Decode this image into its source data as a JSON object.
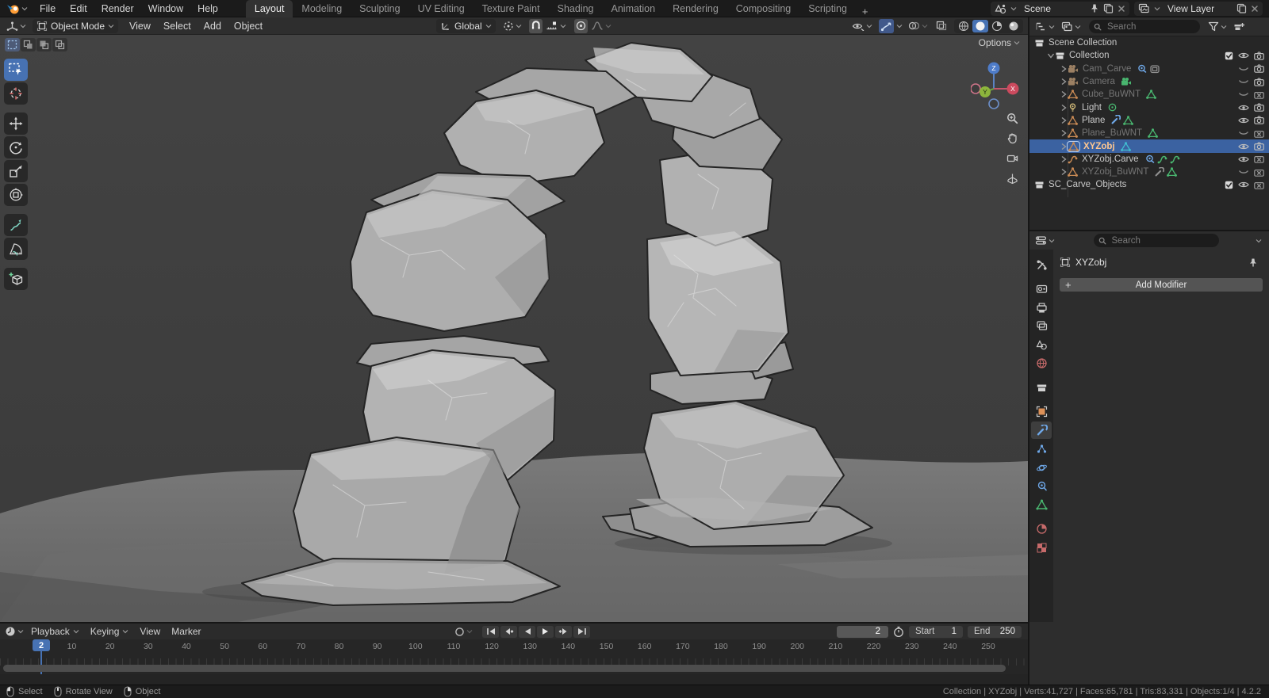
{
  "colors": {
    "accent": "#4772b3",
    "object-orange": "#dd9158",
    "modifier-blue": "#6fa8e8",
    "data-green": "#49b56f",
    "data-teal": "#41bcd0",
    "world-red": "#c66a6a"
  },
  "topbar": {
    "menus": [
      "File",
      "Edit",
      "Render",
      "Window",
      "Help"
    ],
    "workspaces": [
      "Layout",
      "Modeling",
      "Sculpting",
      "UV Editing",
      "Texture Paint",
      "Shading",
      "Animation",
      "Rendering",
      "Compositing",
      "Scripting"
    ],
    "active_workspace": "Layout",
    "new_workspace_label": "+",
    "scene": {
      "value": "Scene"
    },
    "view_layer": {
      "value": "View Layer"
    }
  },
  "viewport": {
    "header": {
      "mode": "Object Mode",
      "menus": [
        "View",
        "Select",
        "Add",
        "Object"
      ],
      "orientation": "Global"
    },
    "options_label": "Options"
  },
  "toolbar": {
    "tools": [
      {
        "name": "select-box",
        "active": true
      },
      {
        "name": "cursor"
      },
      {
        "name": "move",
        "group_gap": true
      },
      {
        "name": "rotate"
      },
      {
        "name": "scale"
      },
      {
        "name": "transform"
      },
      {
        "name": "annotate",
        "group_gap": true
      },
      {
        "name": "measure"
      },
      {
        "name": "add-cube",
        "group_gap": true
      }
    ]
  },
  "outliner": {
    "search_placeholder": "Search",
    "rows": [
      {
        "name": "Scene Collection",
        "icon": "collection",
        "level": 0,
        "badges": [],
        "toggles": []
      },
      {
        "name": "Collection",
        "icon": "collection",
        "level": 1,
        "expand": "open",
        "badges": [],
        "toggles": [
          "check",
          "eye-open",
          "camera"
        ]
      },
      {
        "name": "Cam_Carve",
        "icon": "camera-obj",
        "level": 2,
        "expand": "closed",
        "dimmed": true,
        "badges": [
          "constraint",
          "camera-data-dim"
        ],
        "toggles": [
          "eye-closed",
          "camera"
        ]
      },
      {
        "name": "Camera",
        "icon": "camera-obj",
        "level": 2,
        "expand": "closed",
        "dimmed": true,
        "badges": [
          "camera-data"
        ],
        "toggles": [
          "eye-closed",
          "camera"
        ]
      },
      {
        "name": "Cube_BuWNT",
        "icon": "mesh-obj",
        "level": 2,
        "expand": "closed",
        "dimmed": true,
        "badges": [
          "mesh-data"
        ],
        "toggles": [
          "eye-closed",
          "camera-x"
        ]
      },
      {
        "name": "Light",
        "icon": "light-obj",
        "level": 2,
        "expand": "closed",
        "badges": [
          "light-data"
        ],
        "toggles": [
          "eye-open",
          "camera"
        ]
      },
      {
        "name": "Plane",
        "icon": "mesh-obj",
        "level": 2,
        "expand": "closed",
        "badges": [
          "modifier",
          "mesh-data"
        ],
        "toggles": [
          "eye-open",
          "camera"
        ]
      },
      {
        "name": "Plane_BuWNT",
        "icon": "mesh-obj",
        "level": 2,
        "expand": "closed",
        "dimmed": true,
        "badges": [
          "mesh-data"
        ],
        "toggles": [
          "eye-closed",
          "camera-x"
        ]
      },
      {
        "name": "XYZobj",
        "icon": "mesh-obj",
        "level": 2,
        "expand": "closed",
        "selected": true,
        "badges": [
          "mesh-data-teal"
        ],
        "toggles": [
          "eye-open",
          "camera"
        ]
      },
      {
        "name": "XYZobj.Carve",
        "icon": "curve-obj",
        "level": 2,
        "expand": "closed",
        "badges": [
          "constraint",
          "curve-data",
          "curve-data"
        ],
        "toggles": [
          "eye-open",
          "camera-x"
        ]
      },
      {
        "name": "XYZobj_BuWNT",
        "icon": "mesh-obj",
        "level": 2,
        "expand": "closed",
        "dimmed": true,
        "badges": [
          "modifier-dim",
          "mesh-data"
        ],
        "toggles": [
          "eye-closed",
          "camera-x"
        ]
      },
      {
        "name": "SC_Carve_Objects",
        "icon": "collection",
        "level": 0,
        "badges": [],
        "toggles": [
          "check",
          "eye-open",
          "camera-x"
        ]
      }
    ]
  },
  "properties": {
    "search_placeholder": "Search",
    "object_name": "XYZobj",
    "add_modifier_label": "Add Modifier",
    "plus_glyph": "+",
    "tabs": [
      {
        "name": "tool"
      },
      {
        "name": "render",
        "gap": true
      },
      {
        "name": "output"
      },
      {
        "name": "view-layer"
      },
      {
        "name": "scene"
      },
      {
        "name": "world"
      },
      {
        "name": "collection",
        "gap": true
      },
      {
        "name": "object",
        "gap": true
      },
      {
        "name": "modifiers",
        "active": true
      },
      {
        "name": "particles"
      },
      {
        "name": "physics"
      },
      {
        "name": "constraints"
      },
      {
        "name": "data"
      },
      {
        "name": "material",
        "gap": true
      },
      {
        "name": "texture"
      }
    ]
  },
  "timeline": {
    "menus": [
      {
        "label": "Playback",
        "caret": true
      },
      {
        "label": "Keying",
        "caret": true
      },
      {
        "label": "View",
        "caret": false
      },
      {
        "label": "Marker",
        "caret": false
      }
    ],
    "current_frame": "2",
    "start_label": "Start",
    "start_value": "1",
    "end_label": "End",
    "end_value": "250",
    "ruler_frames": [
      10,
      20,
      30,
      40,
      50,
      60,
      70,
      80,
      90,
      100,
      110,
      120,
      130,
      140,
      150,
      160,
      170,
      180,
      190,
      200,
      210,
      220,
      230,
      240,
      250
    ]
  },
  "status_bar": {
    "hints": [
      {
        "button": "left",
        "label": "Select"
      },
      {
        "button": "middle",
        "label": "Rotate View"
      },
      {
        "button": "right",
        "label": "Object"
      }
    ],
    "stats": [
      "Collection",
      "XYZobj",
      "Verts:41,727",
      "Faces:65,781",
      "Tris:83,331",
      "Objects:1/4",
      "4.2.2"
    ],
    "separator": " | "
  }
}
